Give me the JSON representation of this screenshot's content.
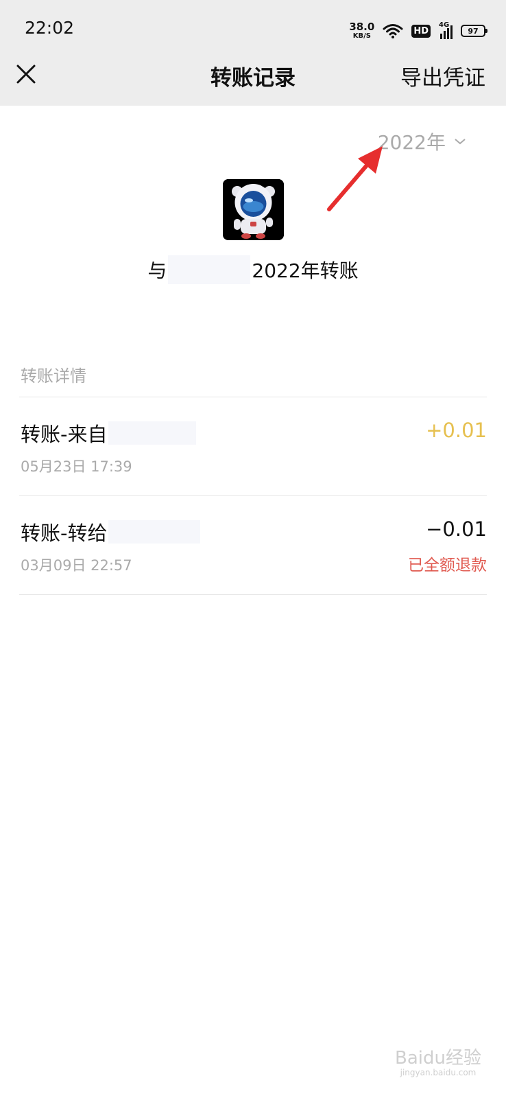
{
  "status_bar": {
    "time": "22:02",
    "speed_value": "38.0",
    "speed_unit": "KB/S",
    "hd": "HD",
    "network": "4G",
    "battery": "97"
  },
  "nav": {
    "title": "转账记录",
    "export_label": "导出凭证"
  },
  "year_picker": {
    "label": "2022年"
  },
  "summary": {
    "prefix": "与",
    "suffix": "2022年转账"
  },
  "section": {
    "title": "转账详情"
  },
  "transactions": [
    {
      "title": "转账-来自",
      "date": "05月23日 17:39",
      "amount": "+0.01",
      "amount_color": "#e6c050",
      "status": ""
    },
    {
      "title": "转账-转给",
      "date": "03月09日 22:57",
      "amount": "−0.01",
      "amount_color": "#111111",
      "status": "已全额退款"
    }
  ],
  "annotation": {
    "arrow_color": "#e62e2e"
  },
  "watermark": {
    "text": "Baidu经验",
    "sub": "jingyan.baidu.com"
  }
}
